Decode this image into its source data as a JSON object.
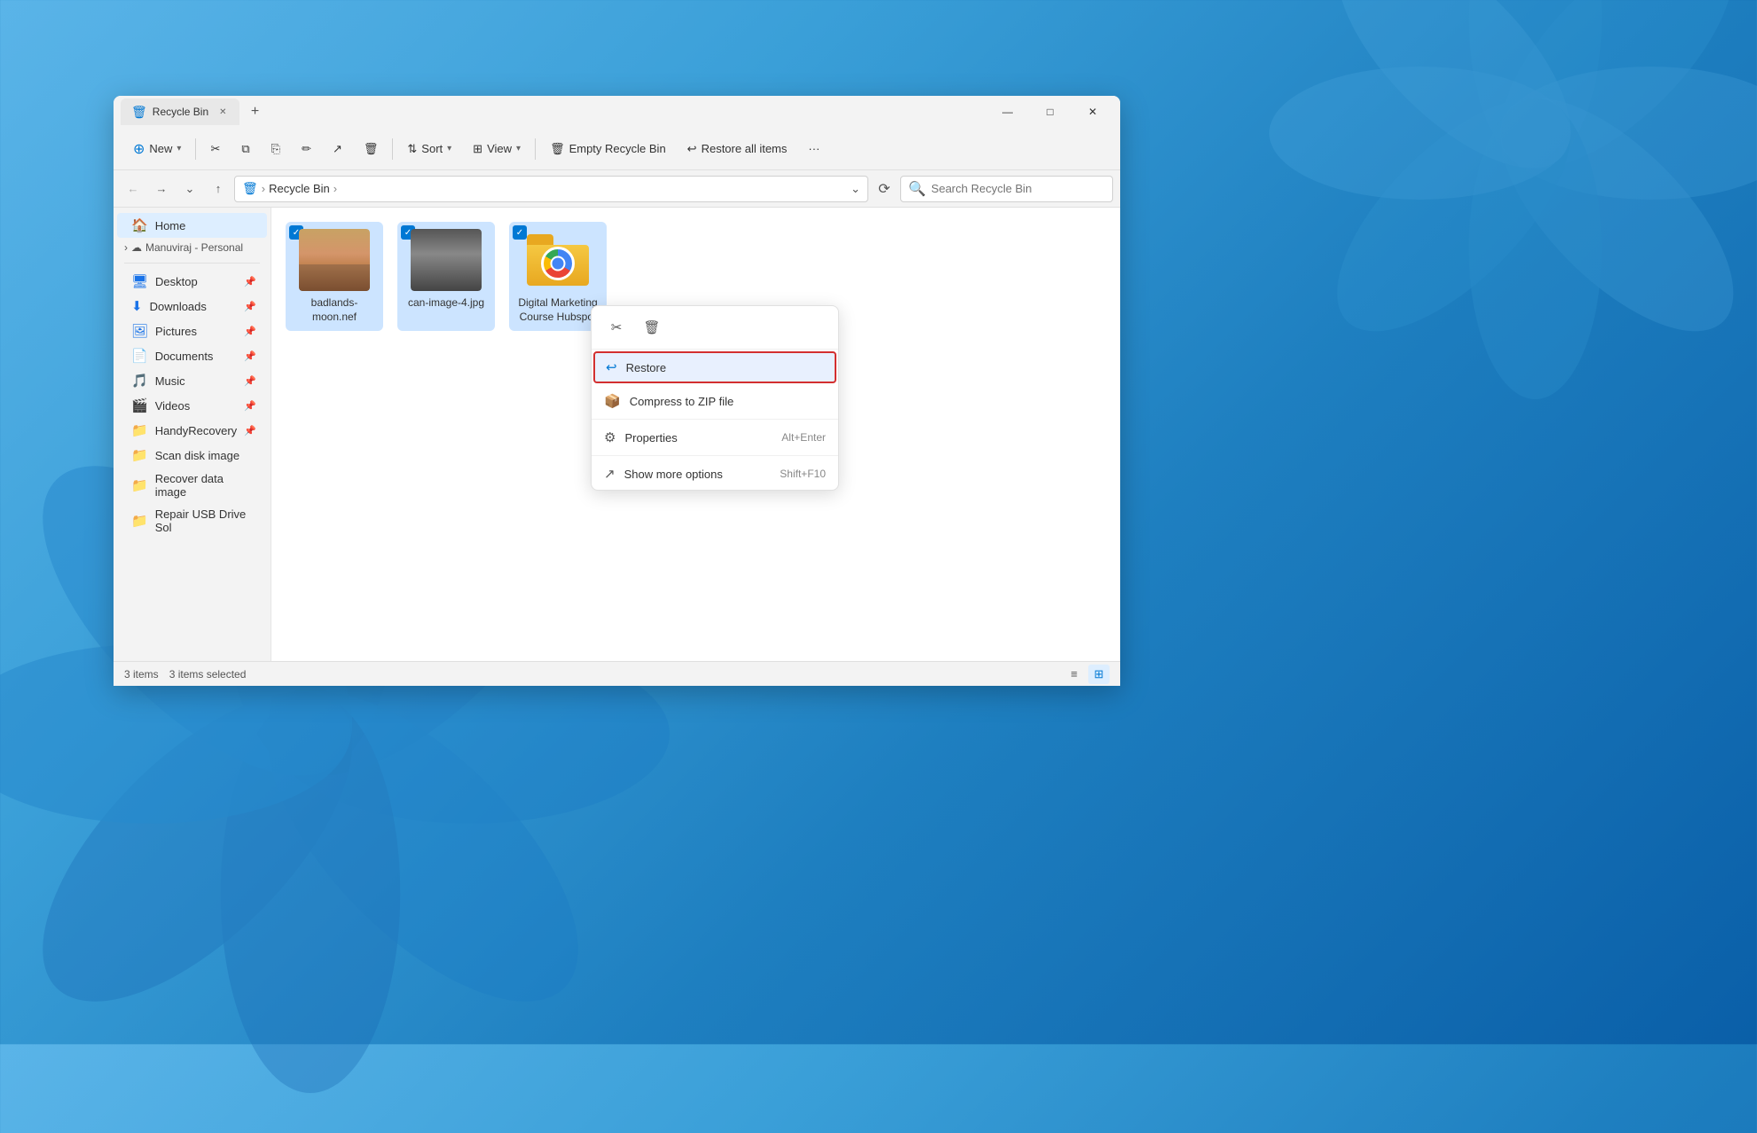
{
  "window": {
    "tab_label": "Recycle Bin",
    "tab_add_label": "+",
    "minimize_label": "—",
    "maximize_label": "□",
    "close_label": "✕"
  },
  "toolbar": {
    "new_label": "New",
    "cut_icon": "✂",
    "copy_icon": "⧉",
    "paste_icon": "📋",
    "rename_icon": "✏",
    "share_icon": "⬆",
    "delete_icon": "🗑",
    "sort_label": "Sort",
    "view_label": "View",
    "empty_bin_label": "Empty Recycle Bin",
    "restore_all_label": "Restore all items",
    "more_label": "···"
  },
  "address_bar": {
    "back_icon": "←",
    "forward_icon": "→",
    "recent_icon": "⌄",
    "up_icon": "↑",
    "path_icon": "🗑",
    "path_parts": [
      "Recycle Bin"
    ],
    "refresh_icon": "⟳",
    "search_placeholder": "Search Recycle Bin"
  },
  "sidebar": {
    "home_label": "Home",
    "cloud_label": "Manuviraj - Personal",
    "items": [
      {
        "label": "Desktop",
        "icon": "🖥",
        "pinned": true
      },
      {
        "label": "Downloads",
        "icon": "⬇",
        "pinned": true
      },
      {
        "label": "Pictures",
        "icon": "🖼",
        "pinned": true
      },
      {
        "label": "Documents",
        "icon": "📄",
        "pinned": true
      },
      {
        "label": "Music",
        "icon": "🎵",
        "pinned": true
      },
      {
        "label": "Videos",
        "icon": "🎬",
        "pinned": true
      },
      {
        "label": "HandyRecovery",
        "icon": "📁",
        "pinned": true
      },
      {
        "label": "Scan disk image",
        "icon": "📁",
        "pinned": false
      },
      {
        "label": "Recover data image",
        "icon": "📁",
        "pinned": false
      },
      {
        "label": "Repair USB Drive Sol",
        "icon": "📁",
        "pinned": false
      }
    ]
  },
  "files": [
    {
      "name": "badlands-moon.nef",
      "type": "image",
      "selected": true
    },
    {
      "name": "can-image-4.jpg",
      "type": "image",
      "selected": true
    },
    {
      "name": "Digital Marketing Course Hubspot",
      "type": "folder",
      "selected": true
    }
  ],
  "context_menu": {
    "cut_icon": "✂",
    "delete_icon": "🗑",
    "restore_label": "Restore",
    "restore_icon": "↩",
    "compress_label": "Compress to ZIP file",
    "compress_icon": "📦",
    "properties_label": "Properties",
    "properties_icon": "⚙",
    "properties_shortcut": "Alt+Enter",
    "more_options_label": "Show more options",
    "more_options_icon": "⬆",
    "more_options_shortcut": "Shift+F10"
  },
  "status_bar": {
    "items_count": "3 items",
    "selected_count": "3 items selected",
    "list_view_icon": "≡",
    "grid_view_icon": "⊞"
  }
}
